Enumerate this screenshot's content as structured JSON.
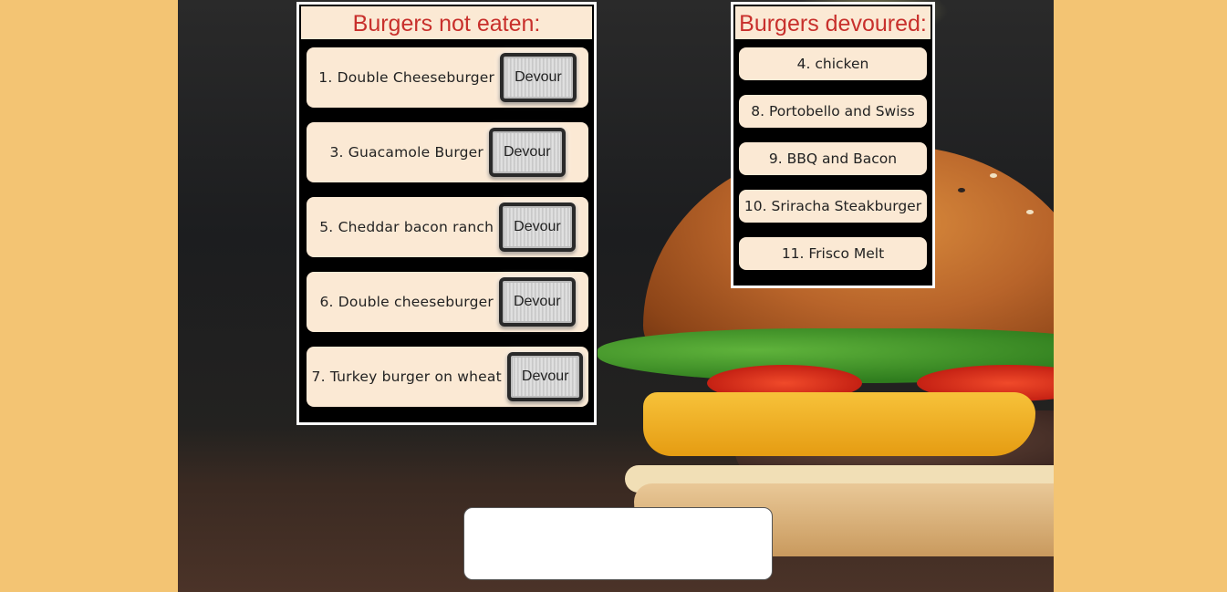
{
  "uncaten": {
    "header": "Burgers not eaten:",
    "items": [
      {
        "label": "1. Double Cheeseburger",
        "button": "Devour"
      },
      {
        "label": "3. Guacamole Burger",
        "button": "Devour"
      },
      {
        "label": "5. Cheddar bacon ranch",
        "button": "Devour"
      },
      {
        "label": "6. Double cheeseburger",
        "button": "Devour"
      },
      {
        "label": "7. Turkey burger on wheat",
        "button": "Devour"
      }
    ]
  },
  "devoured": {
    "header": "Burgers devoured:",
    "items": [
      {
        "label": "4. chicken"
      },
      {
        "label": "8. Portobello and Swiss"
      },
      {
        "label": "9. BBQ and Bacon"
      },
      {
        "label": "10. Sriracha Steakburger"
      },
      {
        "label": "11. Frisco Melt"
      }
    ]
  },
  "new_burger": {
    "value": "",
    "placeholder": ""
  },
  "colors": {
    "page_background": "#f3c473",
    "card_background": "#fbe9d4",
    "header_text": "#c8302c",
    "panel_background": "#000000"
  },
  "background_image": "burger-photo"
}
